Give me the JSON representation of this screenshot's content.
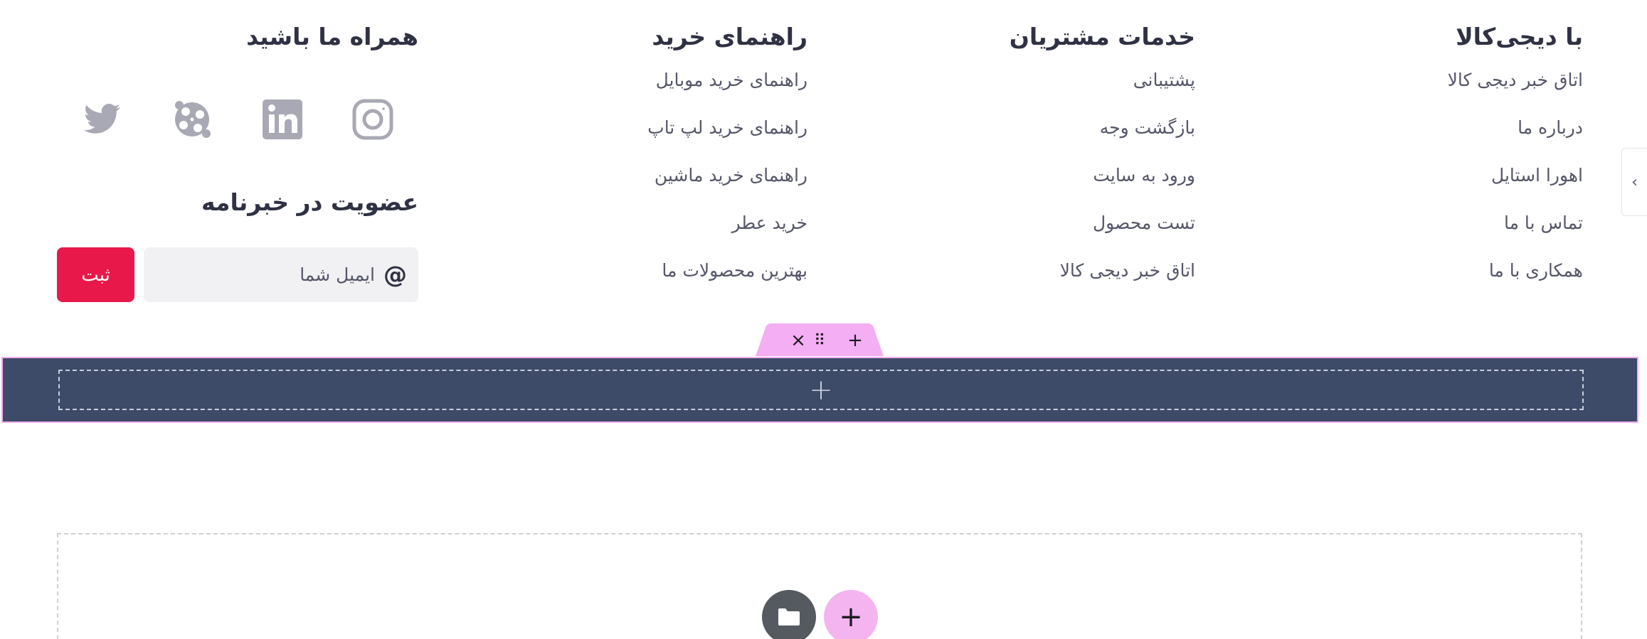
{
  "footer": {
    "columns": [
      {
        "title": "با دیجی‌کالا",
        "links": [
          "اتاق خبر دیجی کالا",
          "درباره ما",
          "اهورا استایل",
          "تماس با ما",
          "همکاری با ما"
        ]
      },
      {
        "title": "خدمات مشتریان",
        "links": [
          "پشتیبانی",
          "بازگشت وجه",
          "ورود به سایت",
          "تست محصول",
          "اتاق خبر دیجی کالا"
        ]
      },
      {
        "title": "راهنمای خرید",
        "links": [
          "راهنمای خرید موبایل",
          "راهنمای خرید لپ تاپ",
          "راهنمای خرید ماشین",
          "خرید عطر",
          "بهترین محصولات ما"
        ]
      }
    ],
    "follow_title": "همراه ما باشید",
    "social_icons": [
      "instagram-icon",
      "linkedin-icon",
      "aparat-icon",
      "twitter-icon"
    ],
    "newsletter": {
      "title": "عضویت در خبرنامه",
      "email_placeholder": "ایمیل شما",
      "at_symbol": "@",
      "submit_label": "ثبت"
    }
  },
  "editor": {
    "tab_controls": {
      "close": "×",
      "drag": "⠿",
      "add": "+"
    },
    "section_add": "+",
    "add_label": "+"
  },
  "colors": {
    "heading": "#2f3144",
    "link": "#55566a",
    "submit": "#e8194a",
    "section_bg": "#3d4a68",
    "editor_accent": "#f4aef3",
    "icon_gray": "#a8a9b4"
  }
}
